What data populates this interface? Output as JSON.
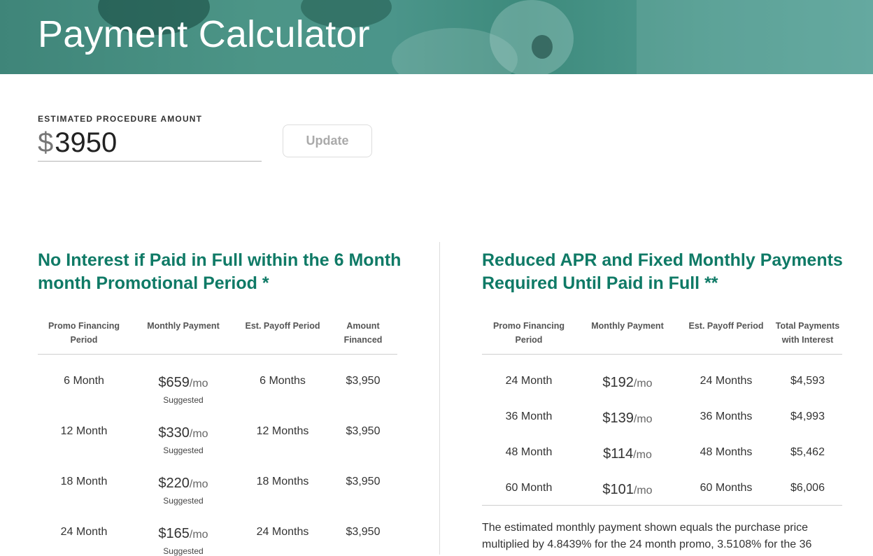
{
  "header": {
    "title": "Payment Calculator"
  },
  "amount": {
    "label": "ESTIMATED PROCEDURE AMOUNT",
    "currency": "$",
    "value": "3950",
    "update_label": "Update"
  },
  "promo": {
    "title": "No Interest if Paid in Full within the 6 Month month Promotional Period *",
    "columns": [
      "Promo Financing Period",
      "Monthly Payment",
      "Est. Payoff Period",
      "Amount Financed"
    ],
    "unit": "/mo",
    "suggested": "Suggested",
    "rows": [
      {
        "period": "6 Month",
        "payment": "$659",
        "payoff": "6 Months",
        "amount": "$3,950"
      },
      {
        "period": "12 Month",
        "payment": "$330",
        "payoff": "12 Months",
        "amount": "$3,950"
      },
      {
        "period": "18 Month",
        "payment": "$220",
        "payoff": "18 Months",
        "amount": "$3,950"
      },
      {
        "period": "24 Month",
        "payment": "$165",
        "payoff": "24 Months",
        "amount": "$3,950"
      }
    ]
  },
  "reduced": {
    "title": "Reduced APR and Fixed Monthly Payments Required Until Paid in Full **",
    "columns": [
      "Promo Financing Period",
      "Monthly Payment",
      "Est. Payoff Period",
      "Total Payments with Interest"
    ],
    "unit": "/mo",
    "rows": [
      {
        "period": "24 Month",
        "payment": "$192",
        "payoff": "24 Months",
        "total": "$4,593"
      },
      {
        "period": "36 Month",
        "payment": "$139",
        "payoff": "36 Months",
        "total": "$4,993"
      },
      {
        "period": "48 Month",
        "payment": "$114",
        "payoff": "48 Months",
        "total": "$5,462"
      },
      {
        "period": "60 Month",
        "payment": "$101",
        "payoff": "60 Months",
        "total": "$6,006"
      }
    ],
    "footnote": "The estimated monthly payment shown equals the purchase price multiplied by 4.8439% for the 24 month promo, 3.5108% for the 36"
  }
}
